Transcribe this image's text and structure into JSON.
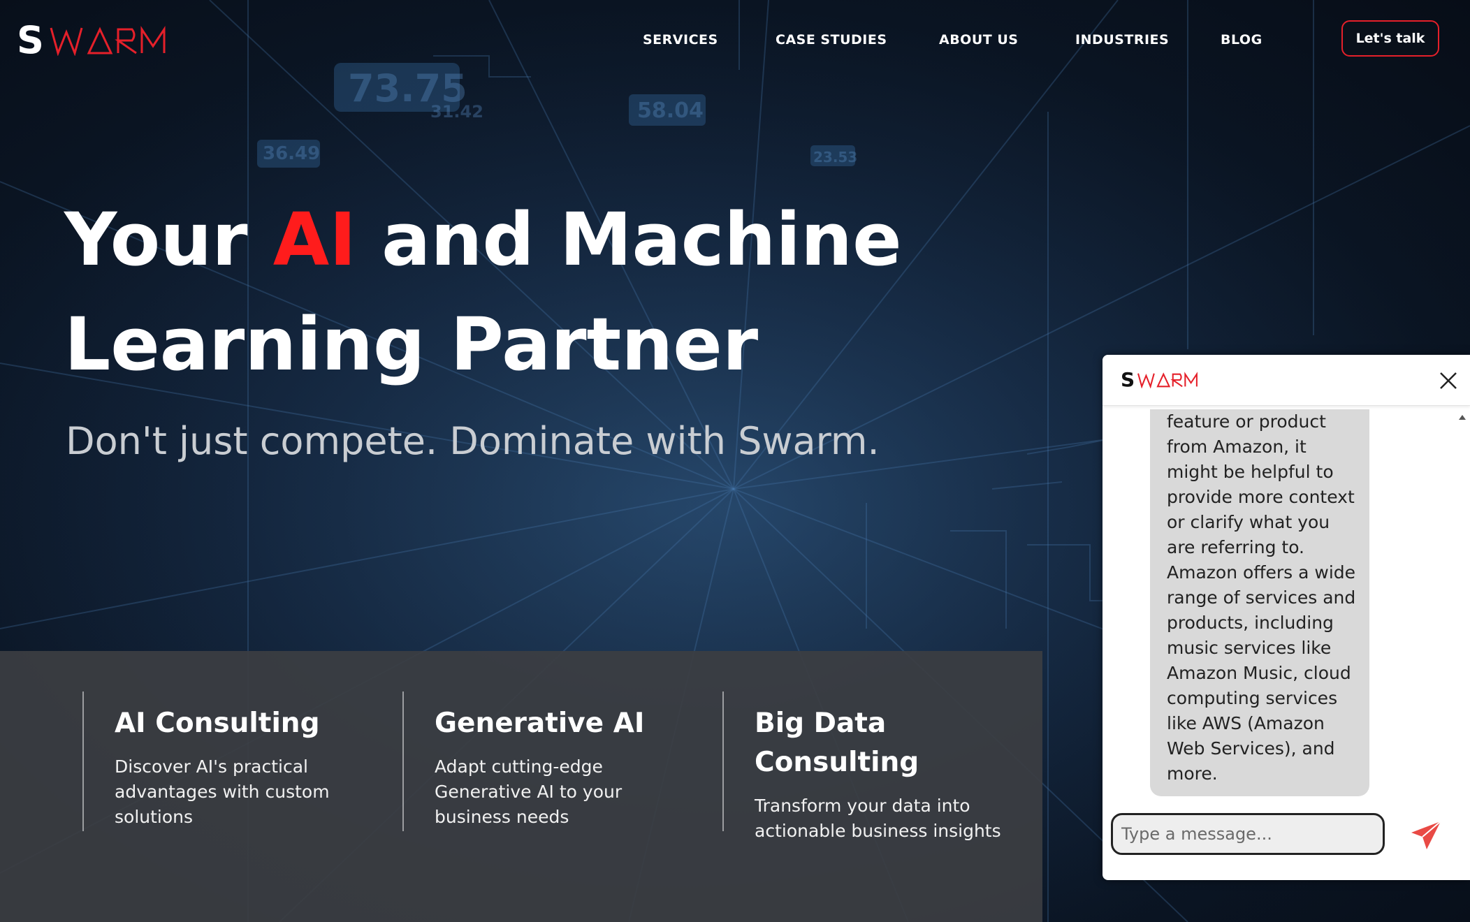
{
  "brand": {
    "logo_initial": "S",
    "logo_rest": "WARM",
    "accent_color": "#e5202a"
  },
  "nav": {
    "items": [
      "SERVICES",
      "CASE STUDIES",
      "ABOUT US",
      "INDUSTRIES",
      "BLOG"
    ],
    "cta_label": "Let's talk"
  },
  "hero": {
    "title_before": "Your ",
    "title_accent": "AI",
    "title_after": " and Machine Learning Partner",
    "subtitle": "Don't just compete. Dominate with Swarm."
  },
  "services": [
    {
      "title": "AI Consulting",
      "description": "Discover AI's practical advantages with custom solutions"
    },
    {
      "title": "Generative AI",
      "description": "Adapt cutting-edge Generative AI to your business needs"
    },
    {
      "title": "Big Data Consulting",
      "description": "Transform your data into actionable business insights"
    }
  ],
  "chat": {
    "logo_initial": "S",
    "logo_rest": "WARM",
    "close_icon": "close-icon",
    "message": "feature or product from Amazon, it might be helpful to provide more context or clarify what you are referring to. Amazon offers a wide range of services and products, including music services like Amazon Music, cloud computing services like AWS (Amazon Web Services), and more.",
    "input_placeholder": "Type a message...",
    "send_icon": "send-icon",
    "send_color": "#e94a45"
  }
}
